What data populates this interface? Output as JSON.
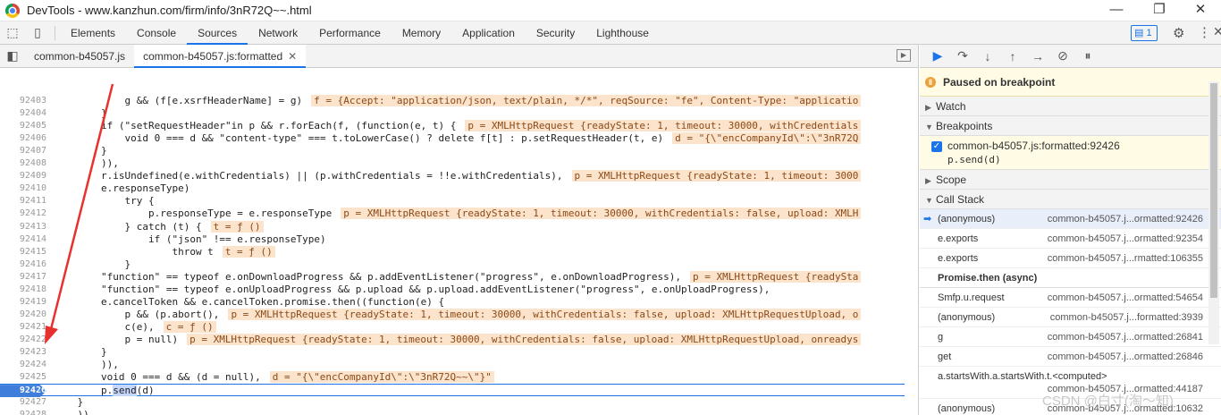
{
  "window": {
    "title": "DevTools - www.kanzhun.com/firm/info/3nR72Q~~.html",
    "minimize": "—",
    "restore": "❐",
    "close": "✕"
  },
  "panel_tabs": [
    "Elements",
    "Console",
    "Sources",
    "Network",
    "Performance",
    "Memory",
    "Application",
    "Security",
    "Lighthouse"
  ],
  "active_panel": "Sources",
  "messages_badge": "1",
  "file_tabs": {
    "first": "common-b45057.js",
    "active": "common-b45057.js:formatted",
    "close": "✕"
  },
  "code_lines": [
    {
      "n": "92403",
      "code": "            g && (f[e.xsrfHeaderName] = g)",
      "inline": "f = {Accept: \"application/json, text/plain, */*\", reqSource: \"fe\", Content-Type: \"applicatio"
    },
    {
      "n": "92404",
      "code": "        }",
      "inline": ""
    },
    {
      "n": "92405",
      "code": "        if (\"setRequestHeader\"in p && r.forEach(f, (function(e, t) {",
      "inline": "p = XMLHttpRequest {readyState: 1, timeout: 30000, withCredentials"
    },
    {
      "n": "92406",
      "code": "            void 0 === d && \"content-type\" === t.toLowerCase() ? delete f[t] : p.setRequestHeader(t, e)",
      "inline": "d = \"{\\\"encCompanyId\\\":\\\"3nR72Q"
    },
    {
      "n": "92407",
      "code": "        }",
      "inline": ""
    },
    {
      "n": "92408",
      "code": "        )),",
      "inline": ""
    },
    {
      "n": "92409",
      "code": "        r.isUndefined(e.withCredentials) || (p.withCredentials = !!e.withCredentials),",
      "inline": "p = XMLHttpRequest {readyState: 1, timeout: 3000"
    },
    {
      "n": "92410",
      "code": "        e.responseType)",
      "inline": ""
    },
    {
      "n": "92411",
      "code": "            try {",
      "inline": ""
    },
    {
      "n": "92412",
      "code": "                p.responseType = e.responseType",
      "inline": "p = XMLHttpRequest {readyState: 1, timeout: 30000, withCredentials: false, upload: XMLH"
    },
    {
      "n": "92413",
      "code": "            } catch (t) {",
      "inline": "t = ƒ ()"
    },
    {
      "n": "92414",
      "code": "                if (\"json\" !== e.responseType)",
      "inline": ""
    },
    {
      "n": "92415",
      "code": "                    throw t",
      "inline": "t = ƒ ()"
    },
    {
      "n": "92416",
      "code": "            }",
      "inline": ""
    },
    {
      "n": "92417",
      "code": "        \"function\" == typeof e.onDownloadProgress && p.addEventListener(\"progress\", e.onDownloadProgress),",
      "inline": "p = XMLHttpRequest {readySta"
    },
    {
      "n": "92418",
      "code": "        \"function\" == typeof e.onUploadProgress && p.upload && p.upload.addEventListener(\"progress\", e.onUploadProgress),",
      "inline": ""
    },
    {
      "n": "92419",
      "code": "        e.cancelToken && e.cancelToken.promise.then((function(e) {",
      "inline": ""
    },
    {
      "n": "92420",
      "code": "            p && (p.abort(),",
      "inline": "p = XMLHttpRequest {readyState: 1, timeout: 30000, withCredentials: false, upload: XMLHttpRequestUpload, o"
    },
    {
      "n": "92421",
      "code": "            c(e),",
      "inline": "c = ƒ ()"
    },
    {
      "n": "92422",
      "code": "            p = null)",
      "inline": "p = XMLHttpRequest {readyState: 1, timeout: 30000, withCredentials: false, upload: XMLHttpRequestUpload, onreadys"
    },
    {
      "n": "92423",
      "code": "        }",
      "inline": ""
    },
    {
      "n": "92424",
      "code": "        )),",
      "inline": ""
    },
    {
      "n": "92425",
      "code": "        void 0 === d && (d = null),",
      "inline": "d = \"{\\\"encCompanyId\\\":\\\"3nR72Q~~\\\"}\""
    },
    {
      "n": "92426",
      "code": "        p.send(d)",
      "inline": ""
    },
    {
      "n": "92427",
      "code": "    }",
      "inline": ""
    },
    {
      "n": "92428",
      "code": "    ))",
      "inline": ""
    },
    {
      "n": "92429",
      "code": "}",
      "inline": ""
    }
  ],
  "breakpoint_line": "92426",
  "debugger": {
    "paused": "Paused on breakpoint",
    "watch": "Watch",
    "breakpoints": "Breakpoints",
    "bp_file": "common-b45057.js:formatted:92426",
    "bp_code": "p.send(d)",
    "scope": "Scope",
    "call_stack": "Call Stack",
    "frames": [
      {
        "name": "(anonymous)",
        "loc": "common-b45057.j...ormatted:92426",
        "current": true
      },
      {
        "name": "e.exports",
        "loc": "common-b45057.j...ormatted:92354"
      },
      {
        "name": "e.exports",
        "loc": "common-b45057.j...rmatted:106355"
      },
      {
        "name": "Promise.then (async)",
        "loc": "",
        "async": true
      },
      {
        "name": "Smfp.u.request",
        "loc": "common-b45057.j...ormatted:54654"
      },
      {
        "name": "(anonymous)",
        "loc": "common-b45057.j...formatted:3939"
      },
      {
        "name": "g",
        "loc": "common-b45057.j...ormatted:26841"
      },
      {
        "name": "get",
        "loc": "common-b45057.j...ormatted:26846"
      },
      {
        "name": "a.startsWith.a.startsWith.t.<computed>",
        "loc": "common-b45057.j...ormatted:44187",
        "tall": true
      },
      {
        "name": "(anonymous)",
        "loc": "common-b45057.j...ormatted:10632"
      }
    ]
  },
  "watermark": "CSDN @白寸(淘～知)",
  "colors": {
    "accent": "#1a73e8",
    "breakpoint": "#3f7fdb",
    "inline_value_bg": "#fbe3cc",
    "paused_bg": "#fffbe5",
    "annotation_arrow": "#e8312f"
  }
}
